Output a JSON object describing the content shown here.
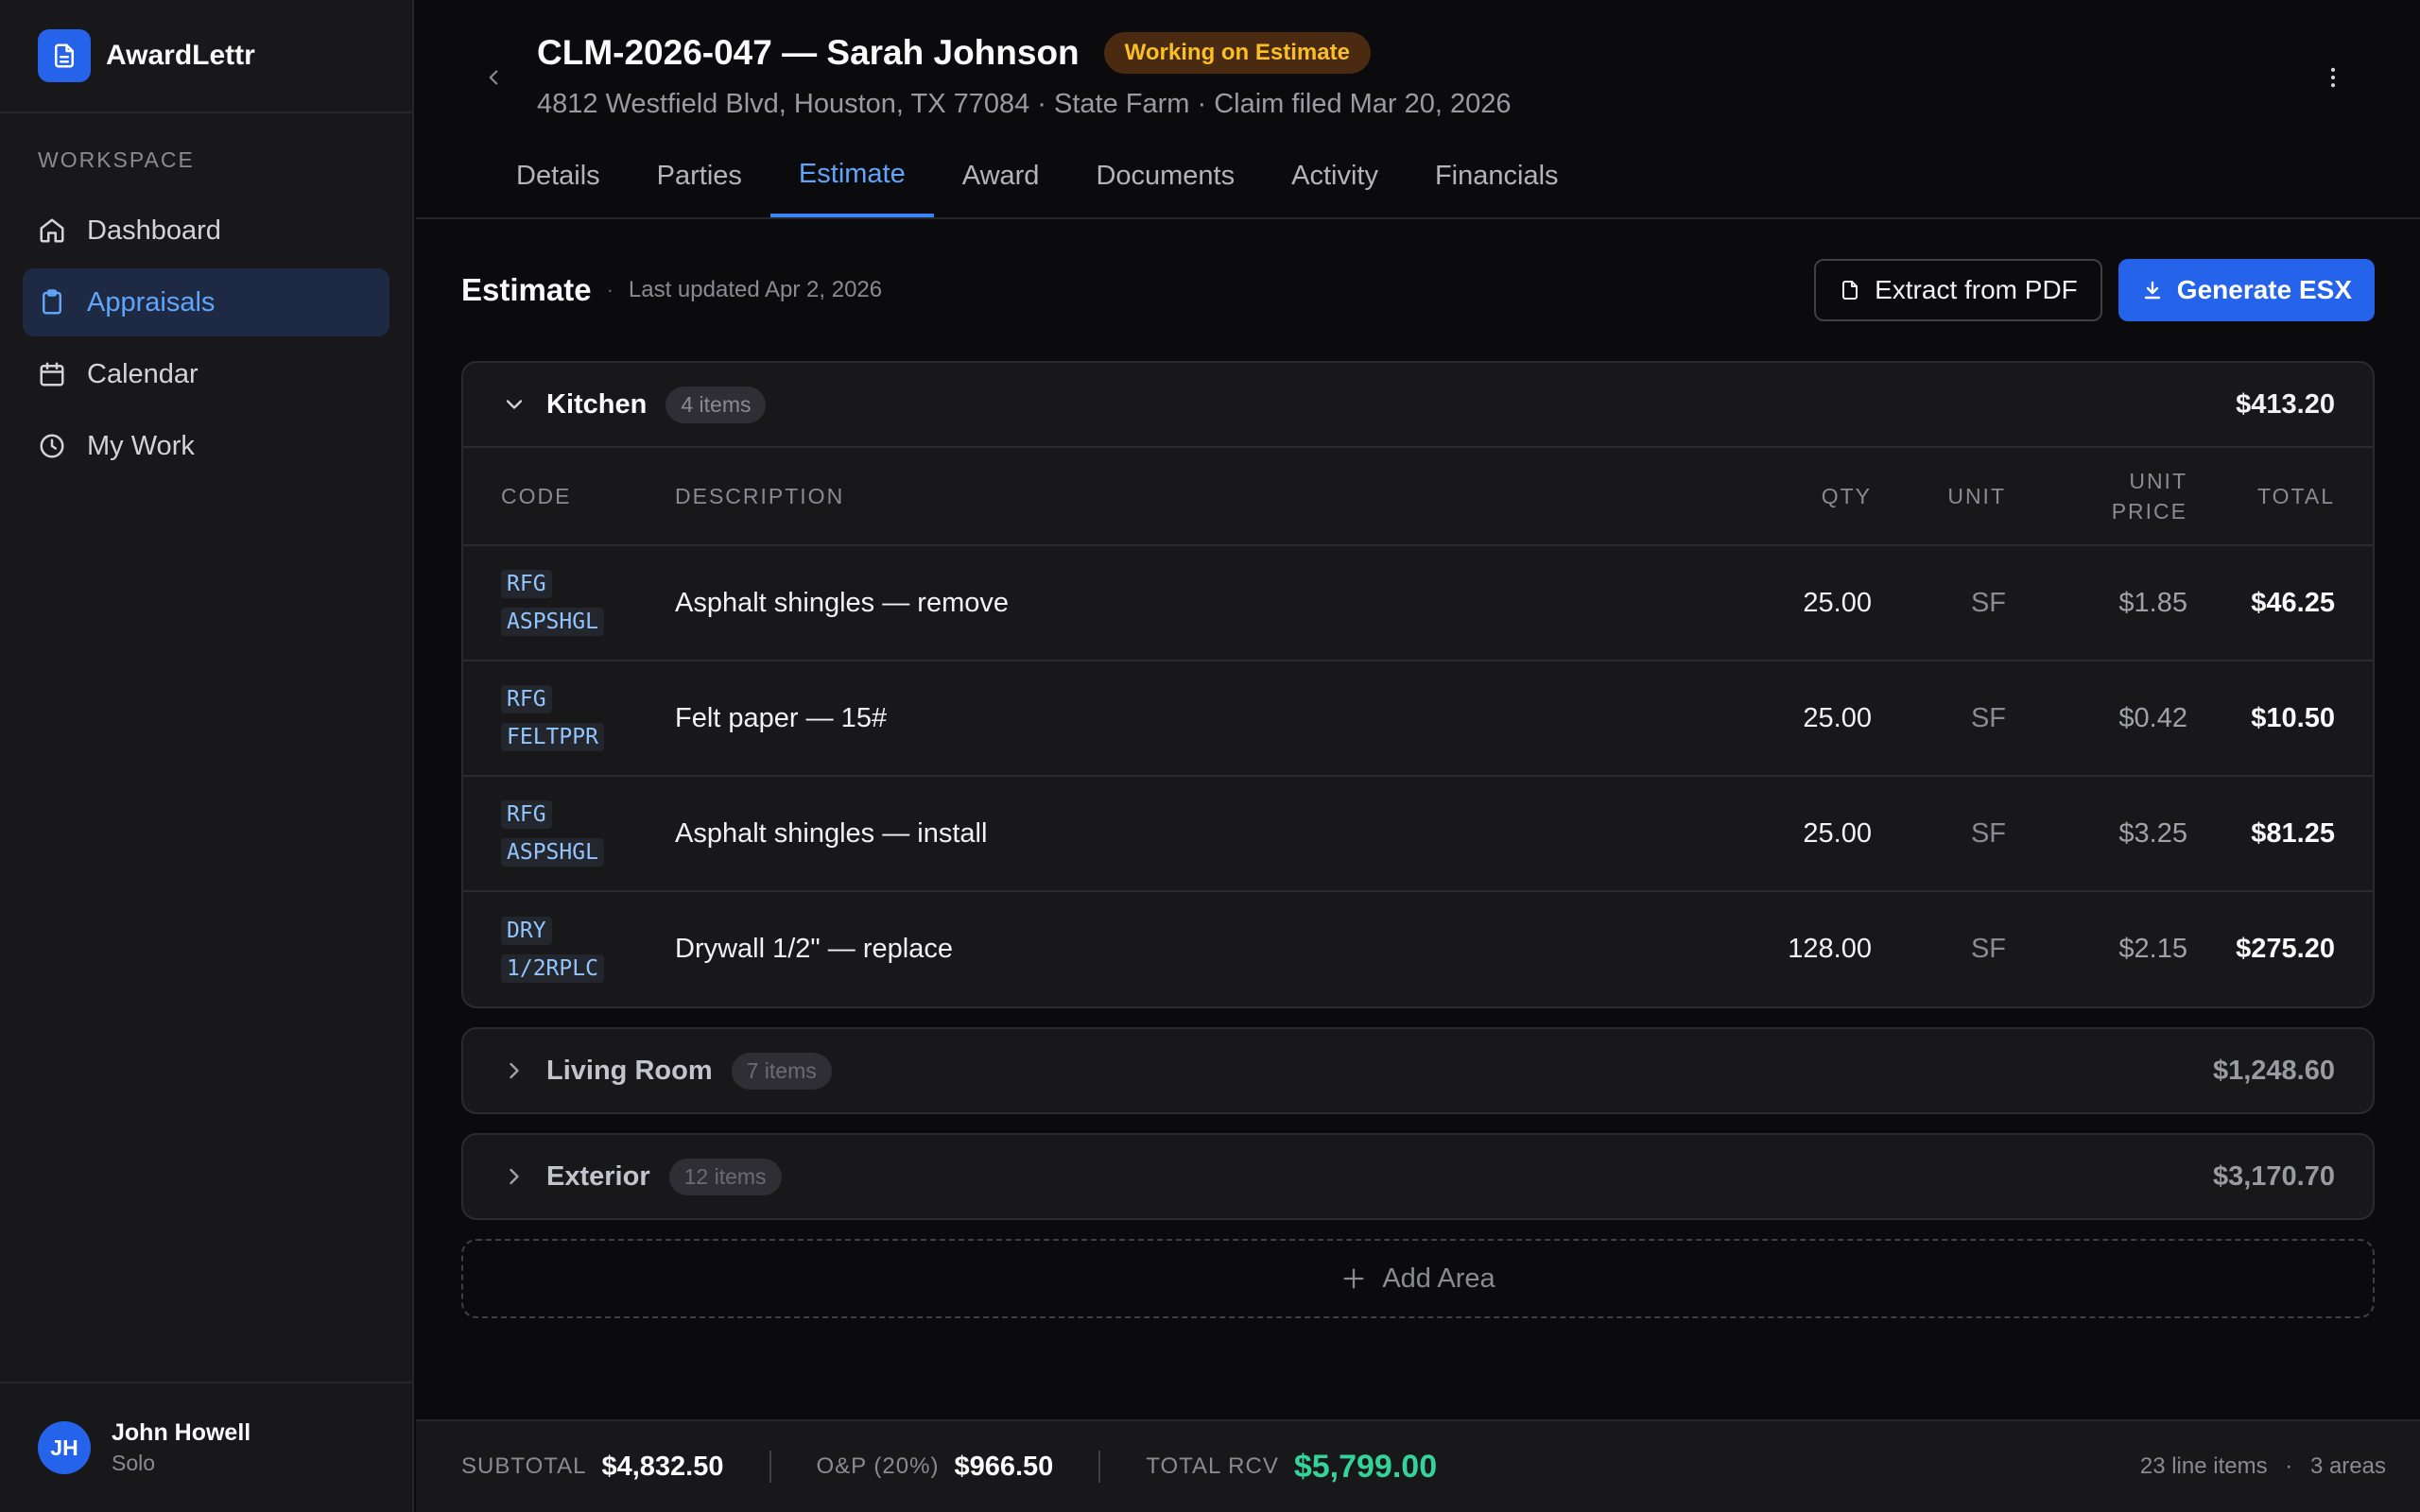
{
  "app": {
    "name": "AwardLettr"
  },
  "sidebar": {
    "section_label": "WORKSPACE",
    "items": [
      {
        "label": "Dashboard",
        "icon": "home-icon"
      },
      {
        "label": "Appraisals",
        "icon": "clipboard-icon",
        "active": true
      },
      {
        "label": "Calendar",
        "icon": "calendar-icon"
      },
      {
        "label": "My Work",
        "icon": "clock-icon"
      }
    ],
    "user": {
      "initials": "JH",
      "name": "John Howell",
      "role": "Solo"
    }
  },
  "header": {
    "title": "CLM-2026-047 — Sarah Johnson",
    "status": "Working on Estimate",
    "subtitle": "4812 Westfield Blvd, Houston, TX 77084 · State Farm · Claim filed Mar 20, 2026",
    "tabs": [
      "Details",
      "Parties",
      "Estimate",
      "Award",
      "Documents",
      "Activity",
      "Financials"
    ],
    "active_tab": "Estimate"
  },
  "estimate": {
    "title": "Estimate",
    "updated": "Last updated Apr 2, 2026",
    "extract_label": "Extract from PDF",
    "generate_label": "Generate ESX",
    "columns": {
      "code": "CODE",
      "description": "DESCRIPTION",
      "qty": "QTY",
      "unit": "UNIT",
      "unit_price": "UNIT PRICE",
      "total": "TOTAL"
    },
    "areas": [
      {
        "name": "Kitchen",
        "count": "4 items",
        "total": "$413.20",
        "expanded": true,
        "rows": [
          {
            "code1": "RFG",
            "code2": "ASPSHGL",
            "description": "Asphalt shingles — remove",
            "qty": "25.00",
            "unit": "SF",
            "unit_price": "$1.85",
            "total": "$46.25"
          },
          {
            "code1": "RFG",
            "code2": "FELTPPR",
            "description": "Felt paper — 15#",
            "qty": "25.00",
            "unit": "SF",
            "unit_price": "$0.42",
            "total": "$10.50"
          },
          {
            "code1": "RFG",
            "code2": "ASPSHGL",
            "description": "Asphalt shingles — install",
            "qty": "25.00",
            "unit": "SF",
            "unit_price": "$3.25",
            "total": "$81.25"
          },
          {
            "code1": "DRY",
            "code2": "1/2RPLC",
            "description": "Drywall 1/2\" — replace",
            "qty": "128.00",
            "unit": "SF",
            "unit_price": "$2.15",
            "total": "$275.20"
          }
        ]
      },
      {
        "name": "Living Room",
        "count": "7 items",
        "total": "$1,248.60",
        "expanded": false
      },
      {
        "name": "Exterior",
        "count": "12 items",
        "total": "$3,170.70",
        "expanded": false
      }
    ],
    "add_area_label": "Add Area"
  },
  "footer": {
    "subtotal_label": "SUBTOTAL",
    "subtotal": "$4,832.50",
    "op_label": "O&P (20%)",
    "op": "$966.50",
    "rcv_label": "TOTAL RCV",
    "rcv": "$5,799.00",
    "line_items": "23 line items",
    "areas": "3 areas"
  },
  "colors": {
    "accent": "#2563eb",
    "active_tab": "#60a5fa",
    "status": "#fbbf24",
    "total_rcv": "#34d399"
  }
}
